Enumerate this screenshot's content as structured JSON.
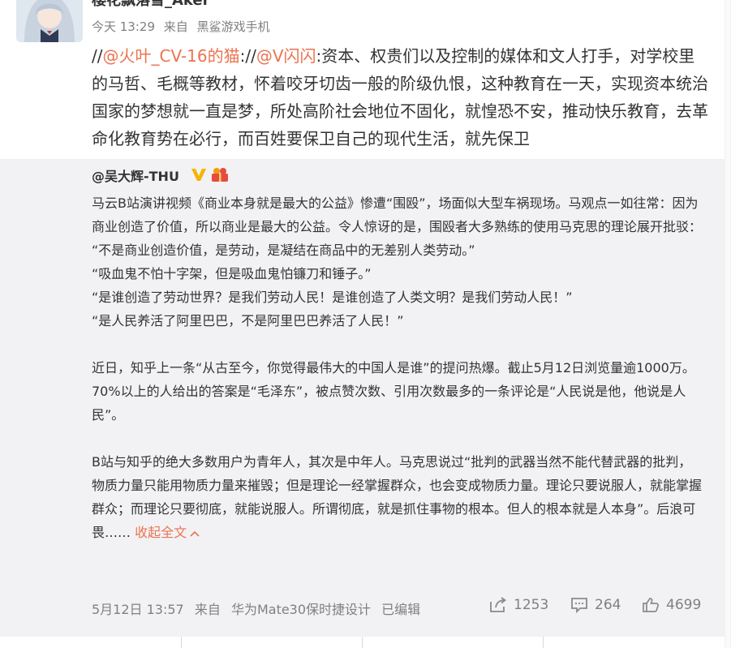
{
  "post": {
    "username": "樱花飘落雪_Aker",
    "time": "今天 13:29",
    "source_prefix": "来自",
    "source": "黑鲨游戏手机",
    "text": {
      "slashes_1": "//",
      "mention_1": "@火叶_CV-16的猫",
      "slashes_2": "://",
      "mention_2": "@V闪闪",
      "body": ":资本、权贵们以及控制的媒体和文人打手，对学校里的马哲、毛概等教材，怀着咬牙切齿一般的阶级仇恨，这种教育在一天，实现资本统治国家的梦想就一直是梦，所处高阶社会地位不固化，就惶恐不安，推动快乐教育，去革命化教育势在必行，而百姓要保卫自己的现代生活，就先保卫"
    }
  },
  "retweet": {
    "username": "@吴大辉-THU",
    "paragraphs": [
      "马云B站演讲视频《商业本身就是最大的公益》惨遭“围殴”，场面似大型车祸现场。马观点一如往常：因为商业创造了价值，所以商业是最大的公益。令人惊讶的是，围殴者大多熟练的使用马克思的理论展开批驳：",
      "“不是商业创造价值，是劳动，是凝结在商品中的无差别人类劳动。”",
      "“吸血鬼不怕十字架，但是吸血鬼怕镰刀和锤子。”",
      "“是谁创造了劳动世界？是我们劳动人民！是谁创造了人类文明？是我们劳动人民！”",
      "“是人民养活了阿里巴巴，不是阿里巴巴养活了人民！”",
      "",
      "近日，知乎上一条“从古至今，你觉得最伟大的中国人是谁”的提问热爆。截止5月12日浏览量逾1000万。70%以上的人给出的答案是“毛泽东”，被点赞次数、引用次数最多的一条评论是“人民说是他，他说是人民”。",
      "",
      "B站与知乎的绝大多数用户为青年人，其次是中年人。马克思说过“批判的武器当然不能代替武器的批判，物质力量只能用物质力量来摧毁；但是理论一经掌握群众，也会变成物质力量。理论只要说服人，就能掌握群众；而理论只要彻底，就能说服人。所谓彻底，就是抓住事物的根本。但人的根本就是人本身”。后浪可畏……"
    ],
    "collapse_label": "收起全文",
    "time": "5月12日 13:57",
    "source_prefix": "来自",
    "source": "华为Mate30保时捷设计",
    "edited_label": "已编辑",
    "repost_count": "1253",
    "comment_count": "264",
    "like_count": "4699"
  },
  "icons": {
    "verified": "verified-v-icon",
    "badge": "gift-badge-icon",
    "repost": "share-icon",
    "comment": "comment-icon",
    "like": "thumbs-up-icon",
    "collapse": "chevron-up-icon"
  },
  "colors": {
    "mention": "#eb7350",
    "muted": "#808080",
    "retweet_bg": "#f2f2f5",
    "verified": "#f5b400"
  }
}
